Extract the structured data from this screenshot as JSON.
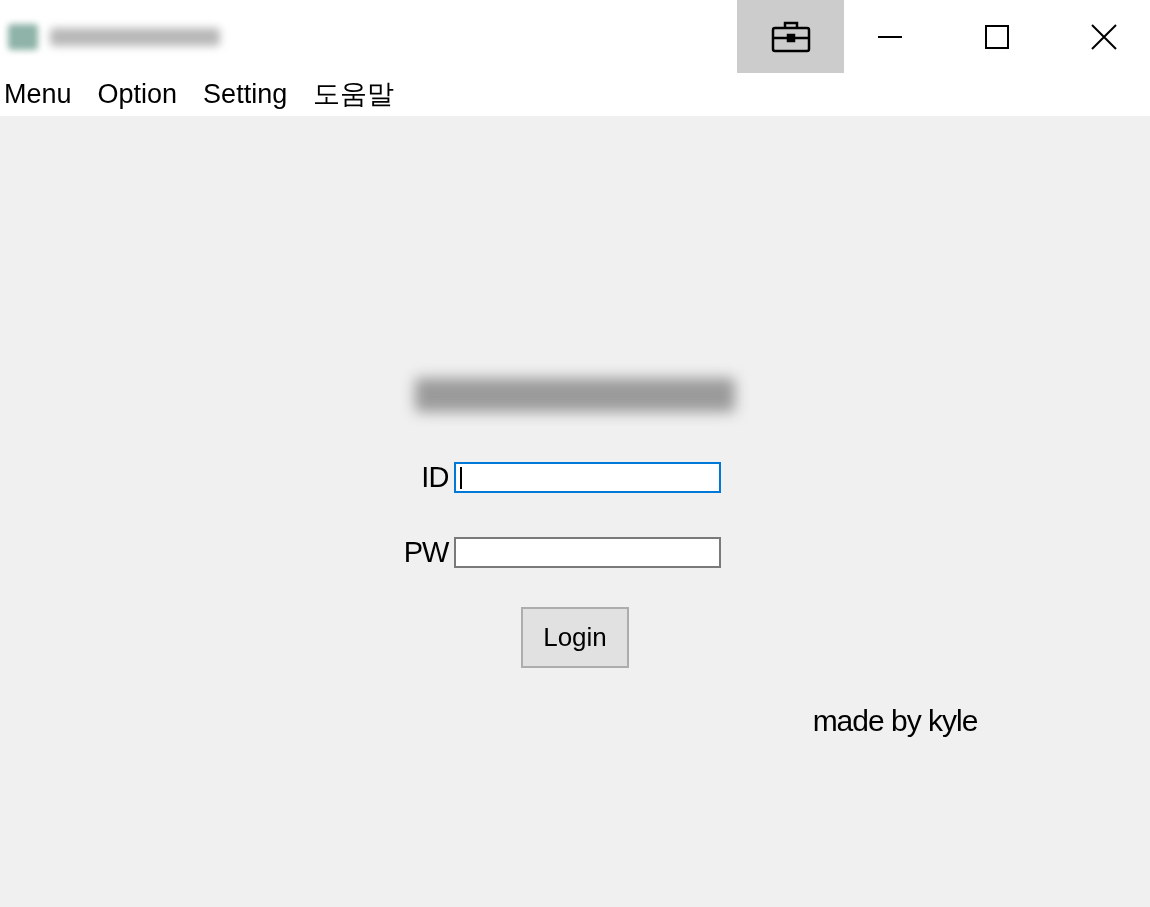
{
  "title_bar": {
    "tool_button_selected": true
  },
  "menu": [
    "Menu",
    "Option",
    "Setting",
    "도움말"
  ],
  "fields": [
    {
      "label": "ID",
      "focused": true
    },
    {
      "label": "PW",
      "focused": false
    }
  ],
  "login_button": "Login",
  "credit": "made by kyle"
}
